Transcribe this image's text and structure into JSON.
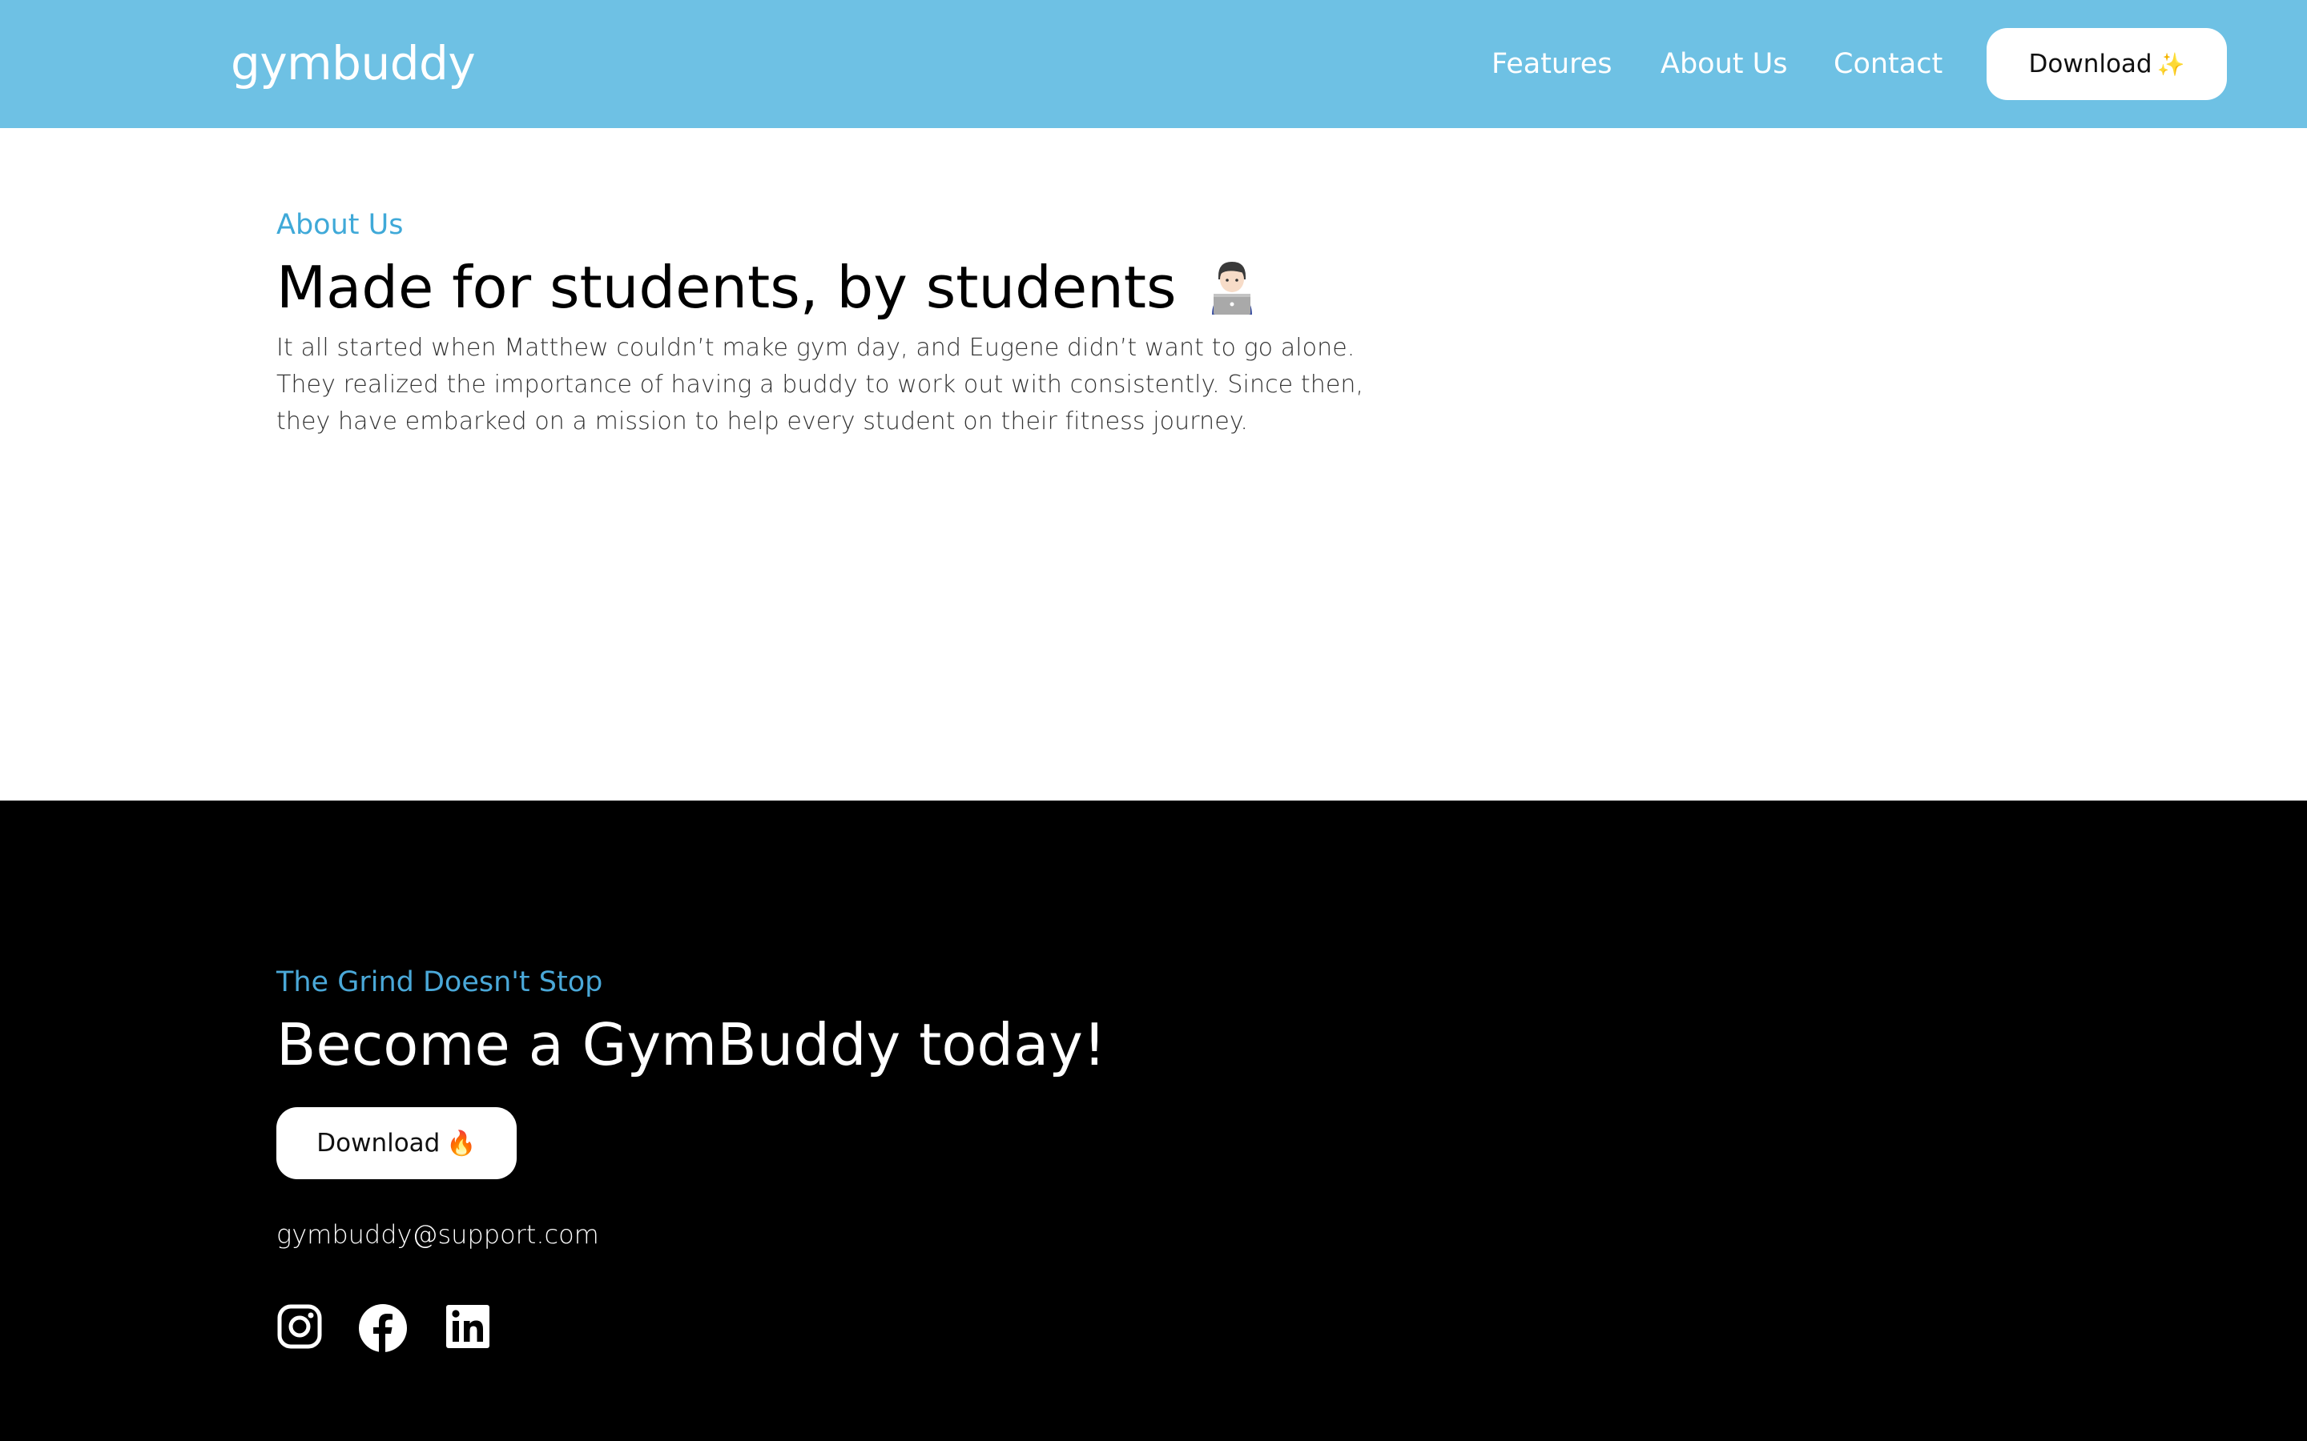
{
  "header": {
    "logo": "gymbuddy",
    "nav": [
      {
        "label": "Features"
      },
      {
        "label": "About Us"
      },
      {
        "label": "Contact"
      }
    ],
    "download_label": "Download",
    "download_icon": "sparkles-icon"
  },
  "about": {
    "eyebrow": "About Us",
    "title": "Made for students, by students",
    "title_icon": "person-with-laptop-icon",
    "body": "It all started when Matthew couldn’t make gym day, and Eugene didn’t want to go alone. They realized the importance of having a buddy to work out with consistently. Since then, they have embarked on a mission to help every student on their fitness journey."
  },
  "footer": {
    "eyebrow": "The Grind Doesn't Stop",
    "title": "Become a GymBuddy today!",
    "download_label": "Download",
    "download_icon": "fire-icon",
    "email": "gymbuddy@support.com",
    "social": [
      {
        "icon": "instagram-icon"
      },
      {
        "icon": "facebook-icon"
      },
      {
        "icon": "linkedin-icon"
      }
    ]
  },
  "colors": {
    "header_bg": "#6ec1e4",
    "accent": "#3fa9d8",
    "footer_bg": "#000000"
  }
}
